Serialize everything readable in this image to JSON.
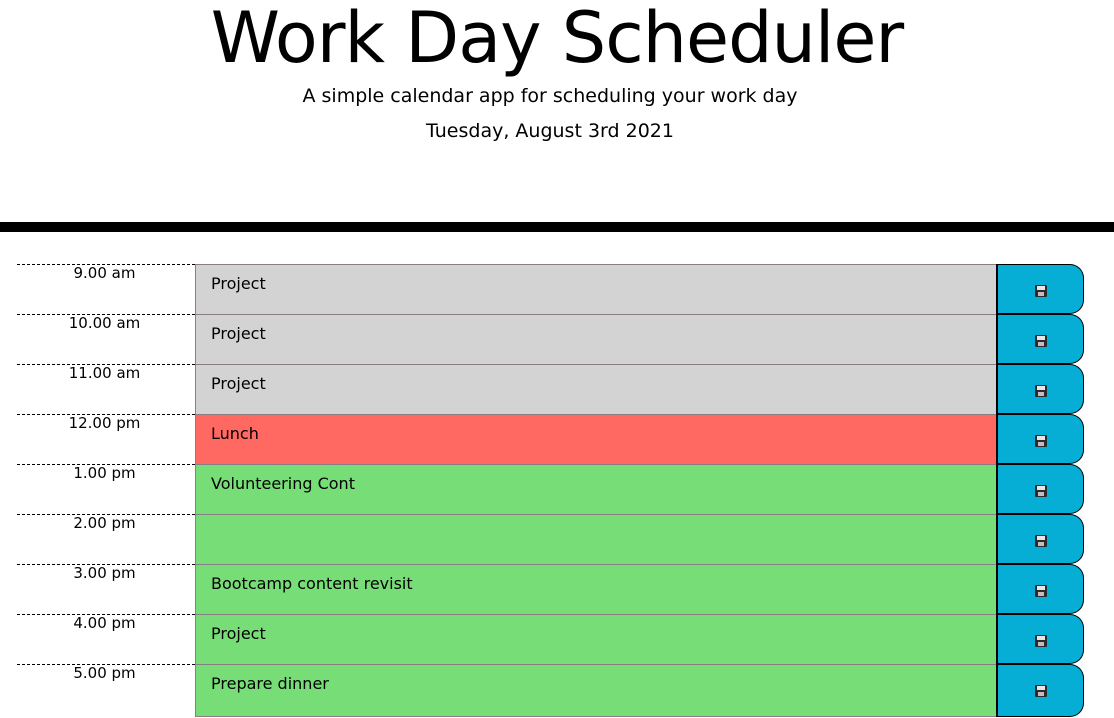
{
  "header": {
    "title": "Work Day Scheduler",
    "subtitle": "A simple calendar app for scheduling your work day",
    "date": "Tuesday, August 3rd 2021"
  },
  "colors": {
    "past": "#d3d3d3",
    "present": "#ff6961",
    "future": "#77dd77",
    "save_button": "#06aed5"
  },
  "schedule": [
    {
      "hour": "9.00 am",
      "text": "Project",
      "status": "past",
      "save_icon": "floppy-disk-icon"
    },
    {
      "hour": "10.00 am",
      "text": "Project",
      "status": "past",
      "save_icon": "floppy-disk-icon"
    },
    {
      "hour": "11.00 am",
      "text": "Project",
      "status": "past",
      "save_icon": "floppy-disk-icon"
    },
    {
      "hour": "12.00 pm",
      "text": "Lunch",
      "status": "present",
      "save_icon": "floppy-disk-icon"
    },
    {
      "hour": "1.00 pm",
      "text": "Volunteering Cont",
      "status": "future",
      "save_icon": "floppy-disk-icon"
    },
    {
      "hour": "2.00 pm",
      "text": "",
      "status": "future",
      "save_icon": "floppy-disk-icon"
    },
    {
      "hour": "3.00 pm",
      "text": "Bootcamp content revisit",
      "status": "future",
      "save_icon": "floppy-disk-icon"
    },
    {
      "hour": "4.00 pm",
      "text": "Project",
      "status": "future",
      "save_icon": "floppy-disk-icon"
    },
    {
      "hour": "5.00 pm",
      "text": "Prepare dinner",
      "status": "future",
      "save_icon": "floppy-disk-icon"
    }
  ]
}
